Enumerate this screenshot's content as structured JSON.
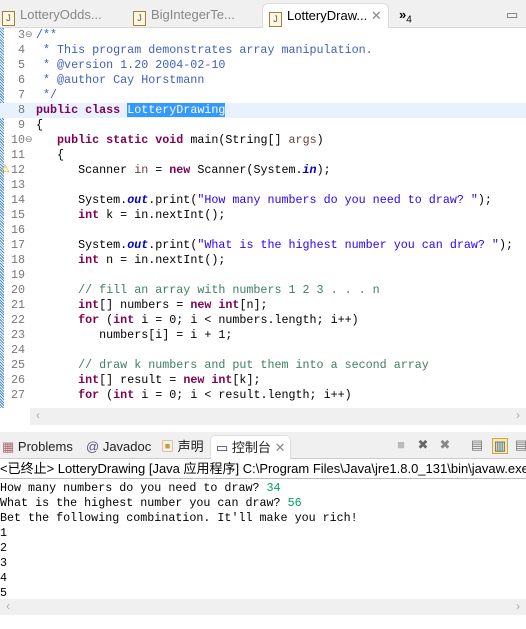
{
  "editor_tabs": [
    {
      "label": "LotteryOdds...",
      "active": false
    },
    {
      "label": "BigIntegerTe...",
      "active": false
    },
    {
      "label": "LotteryDraw...",
      "active": true
    }
  ],
  "overflow_tabs": {
    "label": "»",
    "count": "4"
  },
  "code_lines": [
    {
      "n": "3",
      "fold": true,
      "seg": [
        [
          "cm",
          "/**"
        ]
      ]
    },
    {
      "n": "4",
      "seg": [
        [
          "cm",
          " * This program demonstrates array manipulation."
        ]
      ]
    },
    {
      "n": "5",
      "seg": [
        [
          "cm",
          " * @version 1.20 2004-02-10"
        ]
      ]
    },
    {
      "n": "6",
      "seg": [
        [
          "cm",
          " * @author Cay Horstmann"
        ]
      ]
    },
    {
      "n": "7",
      "seg": [
        [
          "cm",
          " */"
        ]
      ]
    },
    {
      "n": "8",
      "cur": true,
      "seg": [
        [
          "kw",
          "public"
        ],
        [
          "ty",
          " "
        ],
        [
          "kw",
          "class"
        ],
        [
          "ty",
          " "
        ],
        [
          "sel",
          "LotteryDrawing"
        ]
      ]
    },
    {
      "n": "9",
      "seg": [
        [
          "ty",
          "{"
        ]
      ]
    },
    {
      "n": "10",
      "fold": true,
      "seg": [
        [
          "ty",
          "   "
        ],
        [
          "kw",
          "public"
        ],
        [
          "ty",
          " "
        ],
        [
          "kw",
          "static"
        ],
        [
          "ty",
          " "
        ],
        [
          "kw",
          "void"
        ],
        [
          "ty",
          " main(String[] "
        ],
        [
          "var",
          "args"
        ],
        [
          "ty",
          ")"
        ]
      ]
    },
    {
      "n": "11",
      "seg": [
        [
          "ty",
          "   {"
        ]
      ]
    },
    {
      "n": "12",
      "warn": true,
      "seg": [
        [
          "ty",
          "      Scanner "
        ],
        [
          "var",
          "in"
        ],
        [
          "ty",
          " = "
        ],
        [
          "kw",
          "new"
        ],
        [
          "ty",
          " Scanner(System."
        ],
        [
          "fd",
          "in"
        ],
        [
          "ty",
          ");"
        ]
      ]
    },
    {
      "n": "13",
      "seg": []
    },
    {
      "n": "14",
      "seg": [
        [
          "ty",
          "      System."
        ],
        [
          "fd",
          "out"
        ],
        [
          "ty",
          ".print("
        ],
        [
          "st",
          "\"How many numbers do you need to draw? \""
        ],
        [
          "ty",
          ");"
        ]
      ]
    },
    {
      "n": "15",
      "seg": [
        [
          "ty",
          "      "
        ],
        [
          "kw",
          "int"
        ],
        [
          "ty",
          " k = in.nextInt();"
        ]
      ]
    },
    {
      "n": "16",
      "seg": []
    },
    {
      "n": "17",
      "seg": [
        [
          "ty",
          "      System."
        ],
        [
          "fd",
          "out"
        ],
        [
          "ty",
          ".print("
        ],
        [
          "st",
          "\"What is the highest number you can draw? \""
        ],
        [
          "ty",
          ");"
        ]
      ]
    },
    {
      "n": "18",
      "seg": [
        [
          "ty",
          "      "
        ],
        [
          "kw",
          "int"
        ],
        [
          "ty",
          " n = in.nextInt();"
        ]
      ]
    },
    {
      "n": "19",
      "seg": []
    },
    {
      "n": "20",
      "seg": [
        [
          "lc",
          "      // fill an array with numbers 1 2 3 . . . n"
        ]
      ]
    },
    {
      "n": "21",
      "seg": [
        [
          "ty",
          "      "
        ],
        [
          "kw",
          "int"
        ],
        [
          "ty",
          "[] numbers = "
        ],
        [
          "kw",
          "new"
        ],
        [
          "ty",
          " "
        ],
        [
          "kw",
          "int"
        ],
        [
          "ty",
          "[n];"
        ]
      ]
    },
    {
      "n": "22",
      "seg": [
        [
          "ty",
          "      "
        ],
        [
          "kw",
          "for"
        ],
        [
          "ty",
          " ("
        ],
        [
          "kw",
          "int"
        ],
        [
          "ty",
          " i = 0; i < numbers.length; i++)"
        ]
      ]
    },
    {
      "n": "23",
      "seg": [
        [
          "ty",
          "         numbers[i] = i + 1;"
        ]
      ]
    },
    {
      "n": "24",
      "seg": []
    },
    {
      "n": "25",
      "seg": [
        [
          "lc",
          "      // draw k numbers and put them into a second array"
        ]
      ]
    },
    {
      "n": "26",
      "seg": [
        [
          "ty",
          "      "
        ],
        [
          "kw",
          "int"
        ],
        [
          "ty",
          "[] result = "
        ],
        [
          "kw",
          "new"
        ],
        [
          "ty",
          " "
        ],
        [
          "kw",
          "int"
        ],
        [
          "ty",
          "[k];"
        ]
      ]
    },
    {
      "n": "27",
      "seg": [
        [
          "ty",
          "      "
        ],
        [
          "kw",
          "for"
        ],
        [
          "ty",
          " ("
        ],
        [
          "kw",
          "int"
        ],
        [
          "ty",
          " i = 0; i < result.length; i++)"
        ]
      ]
    }
  ],
  "console_tabs": [
    {
      "label": "Problems",
      "icon": "problems-icon"
    },
    {
      "label": "Javadoc",
      "icon": "at-icon"
    },
    {
      "label": "声明",
      "icon": "declaration-icon"
    },
    {
      "label": "控制台",
      "icon": "console-icon",
      "active": true
    }
  ],
  "console": {
    "header": "<已终止> LotteryDrawing [Java 应用程序] C:\\Program Files\\Java\\jre1.8.0_131\\bin\\javaw.exe",
    "lines": [
      {
        "text": "How many numbers do you need to draw? ",
        "input": "34"
      },
      {
        "text": "What is the highest number you can draw? ",
        "input": "56"
      },
      {
        "text": "Bet the following combination. It'll make you rich!"
      },
      {
        "text": "1"
      },
      {
        "text": "2"
      },
      {
        "text": "3"
      },
      {
        "text": "4"
      },
      {
        "text": "5"
      }
    ]
  },
  "colors": {
    "keyword": "#7f0055",
    "comment": "#3f5fbf",
    "string": "#2a00ff",
    "selection": "#3399ff",
    "console_input": "#00a060"
  }
}
